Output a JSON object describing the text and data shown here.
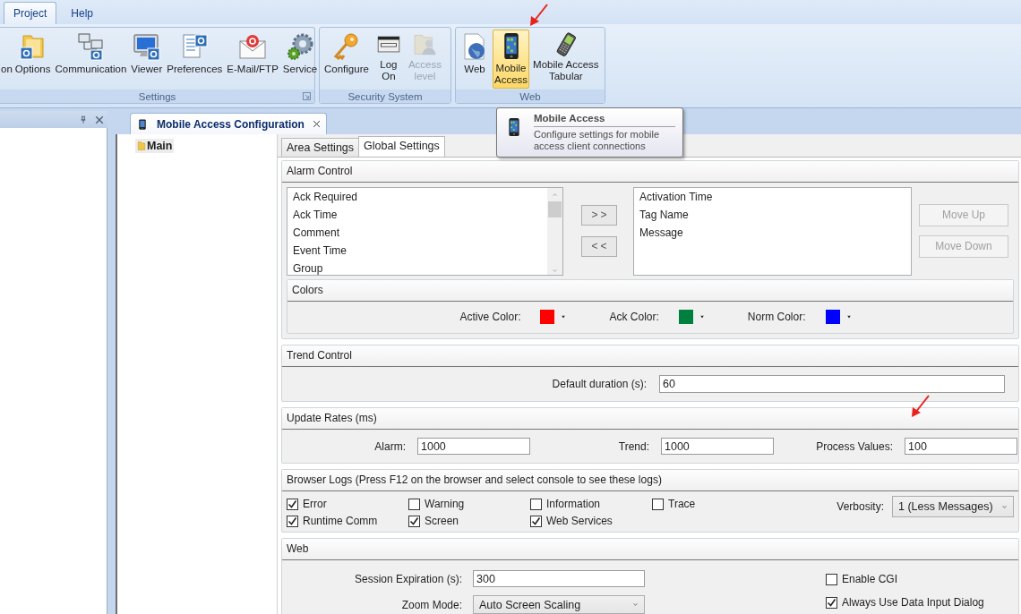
{
  "ribbon": {
    "tabs": [
      {
        "label": "Project",
        "selected": true
      },
      {
        "label": "Help",
        "selected": false
      }
    ],
    "groups": [
      {
        "title": "Settings",
        "launcher": true,
        "buttons": [
          {
            "label": "on",
            "selected": false,
            "disabled": false
          },
          {
            "label": "Options",
            "selected": false,
            "disabled": false
          },
          {
            "label": "Communication",
            "selected": false,
            "disabled": false
          },
          {
            "label": "Viewer",
            "selected": false,
            "disabled": false
          },
          {
            "label": "Preferences",
            "selected": false,
            "disabled": false
          },
          {
            "label": "E-Mail/FTP",
            "selected": false,
            "disabled": false
          },
          {
            "label": "Service",
            "selected": false,
            "disabled": false
          }
        ]
      },
      {
        "title": "Security System",
        "launcher": false,
        "buttons": [
          {
            "label": "Configure",
            "selected": false,
            "disabled": false
          },
          {
            "label": "Log\nOn",
            "selected": false,
            "disabled": false
          },
          {
            "label": "Access\nlevel",
            "selected": false,
            "disabled": true
          }
        ]
      },
      {
        "title": "Web",
        "launcher": false,
        "buttons": [
          {
            "label": "Web",
            "selected": false,
            "disabled": false
          },
          {
            "label": "Mobile\nAccess",
            "selected": true,
            "disabled": false
          },
          {
            "label": "Mobile Access\nTabular",
            "selected": false,
            "disabled": false
          }
        ]
      }
    ]
  },
  "tooltip": {
    "title": "Mobile Access",
    "text": "Configure settings for mobile access client connections"
  },
  "document_tab": {
    "title": "Mobile Access Configuration"
  },
  "tree": [
    {
      "label": "Main",
      "selected": true
    }
  ],
  "settings_tabs": [
    {
      "label": "Area Settings",
      "selected": false
    },
    {
      "label": "Global Settings",
      "selected": true
    }
  ],
  "alarm_control": {
    "title": "Alarm Control",
    "available_columns": [
      "Ack Required",
      "Ack Time",
      "Comment",
      "Event Time",
      "Group"
    ],
    "add_button": ">>",
    "remove_button": "<<",
    "selected_columns": [
      "Activation Time",
      "Tag Name",
      "Message"
    ],
    "order_buttons": [
      {
        "label": "Move Up",
        "disabled": true
      },
      {
        "label": "Move Down",
        "disabled": true
      }
    ],
    "colors": {
      "title": "Colors",
      "items": [
        {
          "label": "Active Color:",
          "color": "#ff0000"
        },
        {
          "label": "Ack Color:",
          "color": "#00803f"
        },
        {
          "label": "Norm Color:",
          "color": "#0000ff"
        }
      ]
    }
  },
  "trend_control": {
    "title": "Trend Control",
    "fields": [
      {
        "label": "Default duration (s):",
        "value": "60"
      }
    ]
  },
  "update_rates": {
    "title": "Update Rates (ms)",
    "fields": [
      {
        "label": "Alarm:",
        "value": "1000"
      },
      {
        "label": "Trend:",
        "value": "1000"
      },
      {
        "label": "Process Values:",
        "value": "100"
      }
    ]
  },
  "browser_logs": {
    "title": "Browser Logs (Press F12 on the browser and select console to see these logs)",
    "checkboxes": [
      {
        "label": "Error",
        "checked": true
      },
      {
        "label": "Warning",
        "checked": false
      },
      {
        "label": "Information",
        "checked": false
      },
      {
        "label": "Trace",
        "checked": false
      },
      {
        "label": "Runtime Comm",
        "checked": true
      },
      {
        "label": "Screen",
        "checked": true
      },
      {
        "label": "Web Services",
        "checked": true
      }
    ],
    "verbosity": {
      "label": "Verbosity:",
      "value": "1 (Less Messages)"
    }
  },
  "web": {
    "title": "Web",
    "session_expiration": {
      "label": "Session Expiration (s):",
      "value": "300"
    },
    "zoom_mode": {
      "label": "Zoom Mode:",
      "value": "Auto Screen Scaling"
    },
    "checkboxes": [
      {
        "label": "Enable CGI",
        "checked": false
      },
      {
        "label": "Always Use Data Input Dialog",
        "checked": true
      }
    ]
  }
}
